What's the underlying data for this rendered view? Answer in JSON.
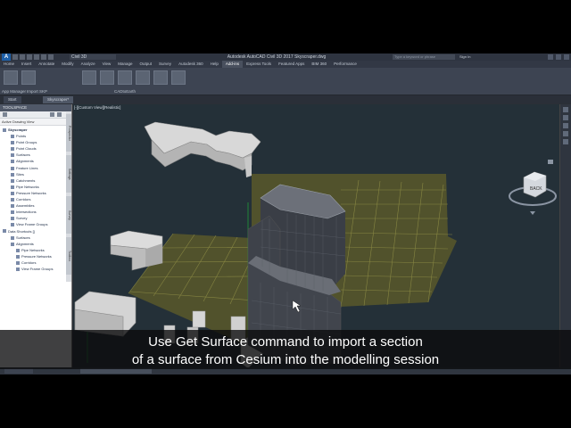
{
  "app": {
    "logo_text": "A",
    "workspace": "Civil 3D",
    "title": "Autodesk AutoCAD Civil 3D 2017   Skyscraper.dwg",
    "search_placeholder": "Type a keyword or phrase",
    "signin": "Sign In"
  },
  "ribbon": {
    "tabs": [
      "Home",
      "Insert",
      "Annotate",
      "Modify",
      "Analyze",
      "View",
      "Manage",
      "Output",
      "Survey",
      "Autodesk 360",
      "Help",
      "Add-ins",
      "Express Tools",
      "Featured Apps",
      "BIM 360",
      "Performance"
    ],
    "active_tab": "Add-ins",
    "panels": [
      "App Manager",
      "Import SKP",
      "CADtoEarth"
    ]
  },
  "file_tabs": [
    "Start",
    "Skyscraper*"
  ],
  "toolspace": {
    "title": "TOOLSPACE",
    "view_label": "Active Drawing View",
    "tree": [
      {
        "label": "Skyscraper",
        "level": 0,
        "bold": true
      },
      {
        "label": "Points",
        "level": 1
      },
      {
        "label": "Point Groups",
        "level": 1
      },
      {
        "label": "Point Clouds",
        "level": 1
      },
      {
        "label": "Surfaces",
        "level": 1
      },
      {
        "label": "Alignments",
        "level": 1
      },
      {
        "label": "Feature Lines",
        "level": 1
      },
      {
        "label": "Sites",
        "level": 1
      },
      {
        "label": "Catchments",
        "level": 1
      },
      {
        "label": "Pipe Networks",
        "level": 1
      },
      {
        "label": "Pressure Networks",
        "level": 1
      },
      {
        "label": "Corridors",
        "level": 1
      },
      {
        "label": "Assemblies",
        "level": 1
      },
      {
        "label": "Intersections",
        "level": 1
      },
      {
        "label": "Survey",
        "level": 1
      },
      {
        "label": "View Frame Groups",
        "level": 1
      },
      {
        "label": "Data Shortcuts []",
        "level": 0
      },
      {
        "label": "Surfaces",
        "level": 1
      },
      {
        "label": "Alignments",
        "level": 1
      },
      {
        "label": "Pipe Networks",
        "level": 2
      },
      {
        "label": "Pressure Networks",
        "level": 2
      },
      {
        "label": "Corridors",
        "level": 2
      },
      {
        "label": "View Frame Groups",
        "level": 2
      }
    ],
    "vertical_tabs": [
      "Prospector",
      "Settings",
      "Survey",
      "Toolbox"
    ]
  },
  "viewport": {
    "label": "[-][Custom View][Realistic]",
    "viewcube_text": "BACK"
  },
  "caption": {
    "line1": "Use Get Surface command to import a section",
    "line2": "of a surface from Cesium into the modelling session"
  }
}
